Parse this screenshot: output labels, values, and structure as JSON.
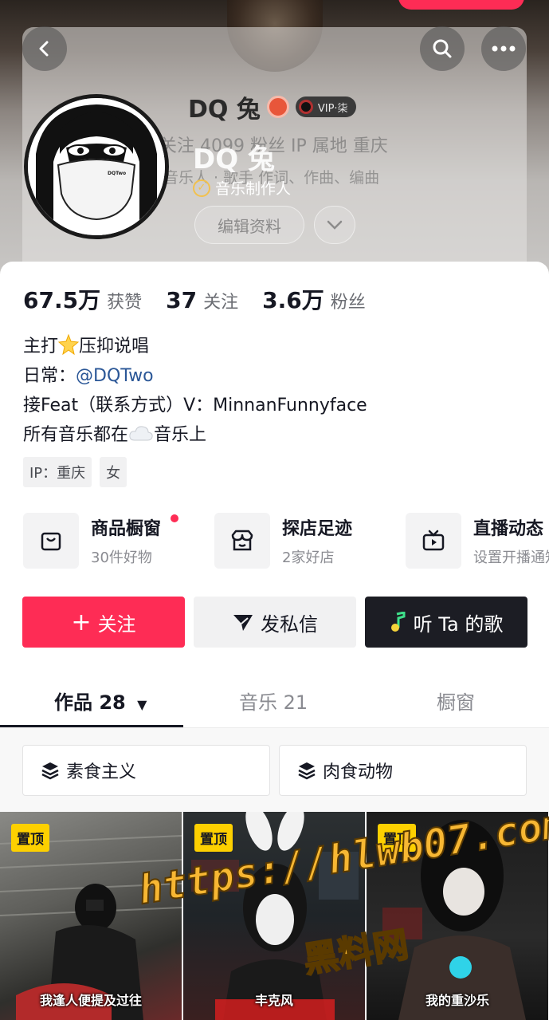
{
  "header": {
    "name": "DQ 兔",
    "vip_label": "VIP·柒",
    "ghost_stats": "关注    4099 粉丝    IP 属地 重庆",
    "ghost_roles": "音乐人 · 歌手    作词、作曲、编曲",
    "overlay_name": "DQ 兔",
    "producer_label": "音乐制作人",
    "edit_button": "编辑资料"
  },
  "stats": [
    {
      "value": "67.5万",
      "label": "获赞"
    },
    {
      "value": "37",
      "label": "关注"
    },
    {
      "value": "3.6万",
      "label": "粉丝"
    }
  ],
  "bio": {
    "line1_a": "主打",
    "line1_b": "压抑说唱",
    "line2_a": "日常：",
    "line2_mention": "@DQTwo",
    "line3": "接Feat（联系方式）V：MinnanFunnyface",
    "line4_a": "所有音乐都在",
    "line4_b": "音乐上"
  },
  "tags": [
    "IP：重庆",
    "女"
  ],
  "services": [
    {
      "title": "商品橱窗",
      "sub": "30件好物",
      "icon": "shopping-bag-icon"
    },
    {
      "title": "探店足迹",
      "sub": "2家好店",
      "icon": "store-icon"
    },
    {
      "title": "直播动态",
      "sub": "设置开播通知",
      "icon": "tv-icon"
    }
  ],
  "actions": {
    "follow": "关注",
    "message": "发私信",
    "music": "听 Ta 的歌"
  },
  "tabs": {
    "works": "作品 28",
    "music": "音乐 21",
    "shop": "橱窗"
  },
  "collections": [
    "素食主义",
    "肉食动物"
  ],
  "videos": [
    {
      "pin": "置顶",
      "caption": "我逢人便提及过往"
    },
    {
      "pin": "置顶",
      "caption": "丰克风"
    },
    {
      "pin": "置顶",
      "caption": "我的重沙乐"
    }
  ],
  "watermark": {
    "url": "https://hlwb07.com",
    "cn": "黑料网"
  },
  "colors": {
    "accent_red": "#fe2c55",
    "dark_button": "#1c1d24",
    "pin_yellow": "#fdd000",
    "mention_blue": "#2b5797"
  }
}
